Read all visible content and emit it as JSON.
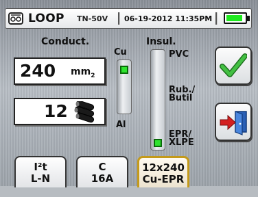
{
  "header": {
    "title": "LOOP",
    "system": "TN-50V",
    "datetime": "06-19-2012 11:35PM",
    "battery_level": 0.9,
    "battery_color": "#1ee81e"
  },
  "conductor": {
    "label": "Conduct.",
    "section_value": "240",
    "section_unit": "mm",
    "section_unit_sup": "2",
    "count_value": "12",
    "material_top": "Cu",
    "material_bottom": "Al",
    "selected": "Cu"
  },
  "insulation": {
    "label": "Insul.",
    "options": [
      "PVC",
      "Rub./Butil",
      "EPR/XLPE"
    ],
    "rub_line1": "Rub./",
    "rub_line2": "Butil",
    "epr_line1": "EPR/",
    "epr_line2": "XLPE",
    "selected": "EPR/XLPE"
  },
  "actions": {
    "confirm_icon": "checkmark-icon",
    "exit_icon": "exit-door-icon"
  },
  "tabs": [
    {
      "line1": "I²t",
      "line2": "L-N",
      "active": false
    },
    {
      "line1": "C",
      "line2": "16A",
      "active": false
    },
    {
      "line1": "12x240",
      "line2": "Cu-EPR",
      "active": true
    }
  ],
  "colors": {
    "indicator": "#2fe32f",
    "active_tab_border": "#c49a1a",
    "check": "#2a9a2a",
    "arrow": "#d42020"
  }
}
